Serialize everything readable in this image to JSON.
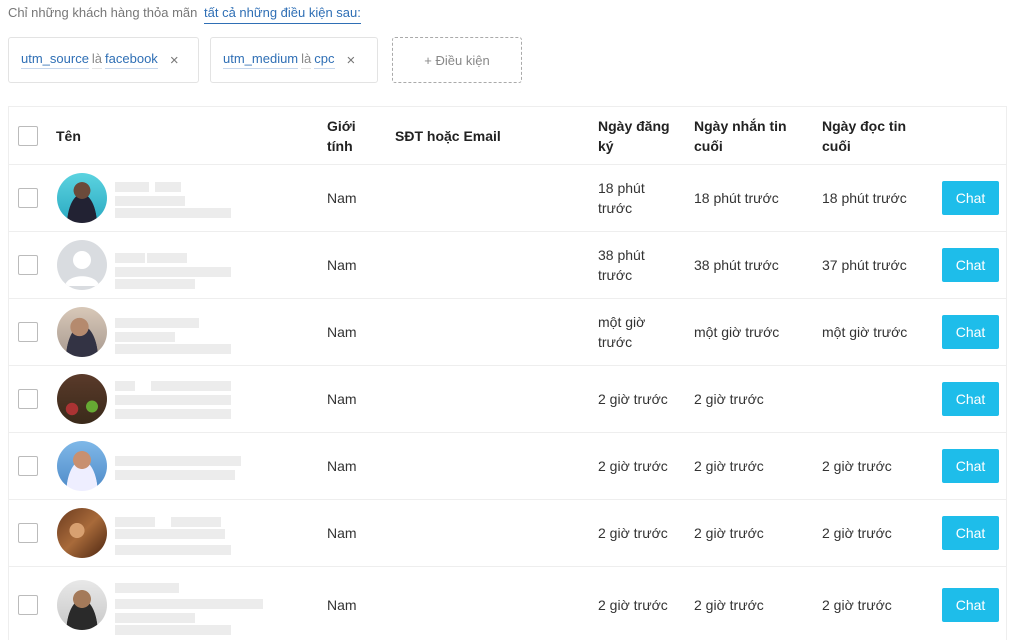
{
  "filter": {
    "prefix": "Chỉ những khách hàng thỏa mãn",
    "mode": "tất cả những điều kiện sau:"
  },
  "conditions": [
    {
      "field": "utm_source",
      "operator": "là",
      "value": "facebook",
      "remove": "×"
    },
    {
      "field": "utm_medium",
      "operator": "là",
      "value": "cpc",
      "remove": "×"
    }
  ],
  "add_condition_label": "+ Điều kiện",
  "table": {
    "headers": {
      "name": "Tên",
      "gender_line1": "Giới",
      "gender_line2": "tính",
      "contact": "SĐT hoặc Email",
      "registered_line1": "Ngày đăng",
      "registered_line2": "ký",
      "last_sent_line1": "Ngày nhắn tin",
      "last_sent_line2": "cuối",
      "last_read_line1": "Ngày đọc tin",
      "last_read_line2": "cuối"
    },
    "chat_label": "Chat",
    "rows": [
      {
        "avatar": "avatar-photo",
        "gender": "Nam",
        "contact": "",
        "registered_line1": "18 phút",
        "registered_line2": "trước",
        "last_sent": "18 phút trước",
        "last_read": "18 phút trước"
      },
      {
        "avatar": "avatar-placeholder-icon",
        "gender": "Nam",
        "contact": "",
        "registered_line1": "38 phút",
        "registered_line2": "trước",
        "last_sent": "38 phút trước",
        "last_read": "37 phút trước"
      },
      {
        "avatar": "avatar-photo",
        "gender": "Nam",
        "contact": "",
        "registered_line1": "một giờ",
        "registered_line2": "trước",
        "last_sent": "một giờ trước",
        "last_read": "một giờ trước"
      },
      {
        "avatar": "avatar-photo",
        "gender": "Nam",
        "contact": "",
        "registered_line1": "2 giờ trước",
        "registered_line2": "",
        "last_sent": "2 giờ trước",
        "last_read": ""
      },
      {
        "avatar": "avatar-photo",
        "gender": "Nam",
        "contact": "",
        "registered_line1": "2 giờ trước",
        "registered_line2": "",
        "last_sent": "2 giờ trước",
        "last_read": "2 giờ trước"
      },
      {
        "avatar": "avatar-photo",
        "gender": "Nam",
        "contact": "",
        "registered_line1": "2 giờ trước",
        "registered_line2": "",
        "last_sent": "2 giờ trước",
        "last_read": "2 giờ trước"
      },
      {
        "avatar": "avatar-photo",
        "gender": "Nam",
        "contact": "",
        "registered_line1": "2 giờ trước",
        "registered_line2": "",
        "last_sent": "2 giờ trước",
        "last_read": "2 giờ trước"
      }
    ]
  },
  "colors": {
    "link": "#2f6fb5",
    "chat_button": "#1ebdea",
    "border": "#eeeeee"
  }
}
